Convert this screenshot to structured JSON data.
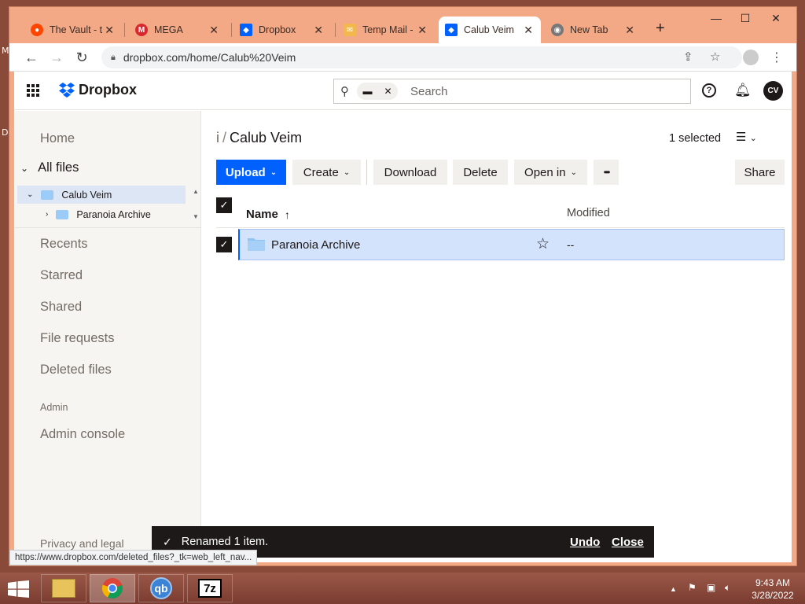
{
  "desktop_edge": {
    "m": "M",
    "d": "D"
  },
  "tabs": [
    {
      "title": "The Vault - t",
      "icon": "reddit-icon",
      "color": "#ff4500"
    },
    {
      "title": "MEGA",
      "icon": "mega-icon",
      "color": "#d9272e"
    },
    {
      "title": "Dropbox",
      "icon": "dropbox-icon",
      "color": "#0061fe"
    },
    {
      "title": "Temp Mail -",
      "icon": "mail-icon",
      "color": "#f2b84b"
    },
    {
      "title": "Calub Veim",
      "icon": "dropbox-icon",
      "color": "#0061fe",
      "active": true
    },
    {
      "title": "New Tab",
      "icon": "chrome-icon",
      "color": "#777777"
    }
  ],
  "window_controls": {
    "minimize": "—",
    "maximize": "☐",
    "close": "✕"
  },
  "address": {
    "url": "dropbox.com/home/Calub%20Veim"
  },
  "dropbox": {
    "brand": "Dropbox",
    "search_placeholder": "Search",
    "avatar_initials": "CV",
    "help_label": "?"
  },
  "sidebar": {
    "home": "Home",
    "all_files": "All files",
    "tree": [
      {
        "label": "Calub Veim",
        "selected": true
      },
      {
        "label": "Paranoia Archive",
        "selected": false
      }
    ],
    "recents": "Recents",
    "starred": "Starred",
    "shared": "Shared",
    "file_requests": "File requests",
    "deleted_files": "Deleted files",
    "admin_header": "Admin",
    "admin_console": "Admin console",
    "privacy": "Privacy and legal"
  },
  "breadcrumb": {
    "root": "i",
    "separator": "/",
    "current": "Calub Veim"
  },
  "selection": "1 selected",
  "actions": {
    "upload": "Upload",
    "create": "Create",
    "download": "Download",
    "delete": "Delete",
    "open_in": "Open in",
    "more": "•••",
    "share": "Share"
  },
  "table": {
    "col_name": "Name",
    "col_modified": "Modified",
    "rows": [
      {
        "name": "Paranoia Archive",
        "modified": "--",
        "selected": true
      }
    ]
  },
  "snackbar": {
    "message": "Renamed 1 item.",
    "undo": "Undo",
    "close": "Close"
  },
  "status_url": "https://www.dropbox.com/deleted_files?_tk=web_left_nav...",
  "taskbar": {
    "apps": [
      "file-explorer",
      "chrome",
      "qbittorrent",
      "7zip"
    ],
    "qb_label": "qb",
    "z7_label": "7z",
    "time": "9:43 AM",
    "date": "3/28/2022"
  }
}
